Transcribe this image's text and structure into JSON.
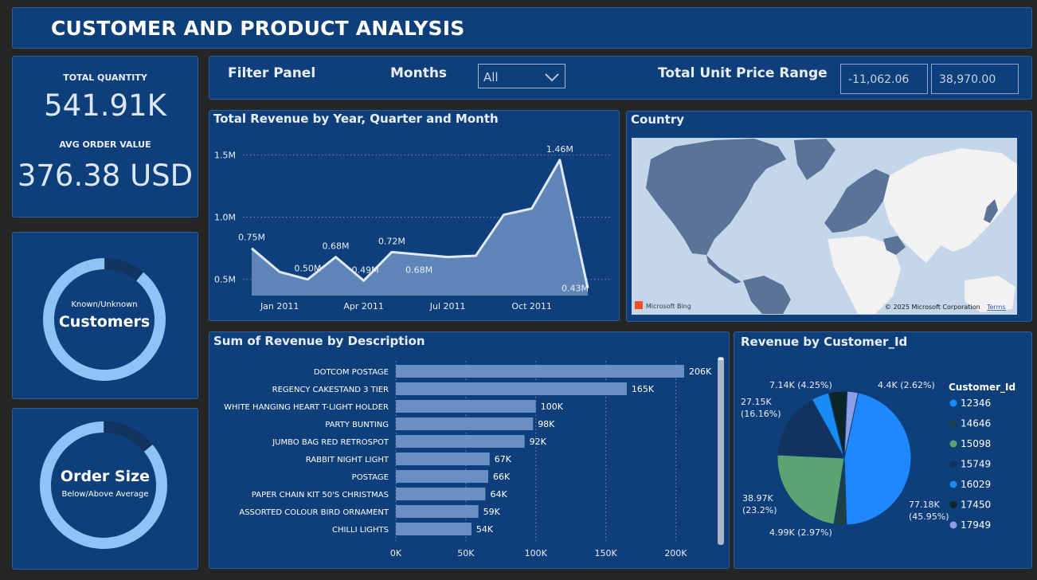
{
  "header": {
    "title": "CUSTOMER AND PRODUCT ANALYSIS"
  },
  "kpis": {
    "total_quantity_label": "TOTAL QUANTITY",
    "total_quantity_value": "541.91K",
    "avg_order_label": "AVG ORDER VALUE",
    "avg_order_value": "376.38 USD"
  },
  "customers_gauge": {
    "line1": "Known/Unknown",
    "line2": "Customers",
    "fraction": 0.89
  },
  "order_size_gauge": {
    "line1": "Order Size",
    "line2": "Below/Above Average",
    "fraction": 0.86
  },
  "filter": {
    "panel_label": "Filter Panel",
    "months_label": "Months",
    "months_value": "All",
    "range_label": "Total Unit Price Range",
    "range_min": "-11,062.06",
    "range_max": "38,970.00"
  },
  "revenue_by_month": {
    "title": "Total Revenue by Year, Quarter and Month"
  },
  "country": {
    "title": "Country",
    "bing_label": "Microsoft Bing",
    "copyright": "© 2025 Microsoft Corporation",
    "terms": "Terms"
  },
  "revenue_by_description": {
    "title": "Sum of Revenue by Description"
  },
  "revenue_by_customer": {
    "title": "Revenue by Customer_Id",
    "legend_title": "Customer_Id"
  },
  "colors": {
    "background": "#262626",
    "panel": "#0f3f7a",
    "accent": "#8ec4f5",
    "line_fill": "#5f85b8",
    "bar": "#6a8fc4"
  },
  "chart_data": [
    {
      "type": "area",
      "title": "Total Revenue by Year, Quarter and Month",
      "x": [
        "Dec 2010",
        "Jan 2011",
        "Feb 2011",
        "Mar 2011",
        "Apr 2011",
        "May 2011",
        "Jun 2011",
        "Jul 2011",
        "Aug 2011",
        "Sep 2011",
        "Oct 2011",
        "Nov 2011",
        "Dec 2011"
      ],
      "x_tick_labels": [
        "Jan 2011",
        "Apr 2011",
        "Jul 2011",
        "Oct 2011"
      ],
      "values": [
        750000,
        560000,
        500000,
        680000,
        490000,
        720000,
        700000,
        680000,
        690000,
        1020000,
        1070000,
        1460000,
        430000
      ],
      "data_labels": [
        "0.75M",
        "",
        "0.50M",
        "0.68M",
        "0.49M",
        "0.72M",
        "",
        "0.68M",
        "",
        "",
        "",
        "1.46M",
        "0.43M"
      ],
      "y_tick_labels": [
        "0.5M",
        "1.0M",
        "1.5M"
      ],
      "y_ticks": [
        500000,
        1000000,
        1500000
      ],
      "ylim": [
        370000,
        1600000
      ],
      "grid": true
    },
    {
      "type": "bar",
      "orientation": "horizontal",
      "title": "Sum of Revenue by Description",
      "categories": [
        "DOTCOM POSTAGE",
        "REGENCY CAKESTAND 3 TIER",
        "WHITE HANGING HEART T-LIGHT HOLDER",
        "PARTY BUNTING",
        "JUMBO BAG RED RETROSPOT",
        "RABBIT NIGHT LIGHT",
        "POSTAGE",
        "PAPER CHAIN KIT 50'S CHRISTMAS",
        "ASSORTED COLOUR BIRD ORNAMENT",
        "CHILLI LIGHTS"
      ],
      "values": [
        206000,
        165000,
        100000,
        98000,
        92000,
        67000,
        66000,
        64000,
        59000,
        54000
      ],
      "data_labels": [
        "206K",
        "165K",
        "100K",
        "98K",
        "92K",
        "67K",
        "66K",
        "64K",
        "59K",
        "54K"
      ],
      "x_tick_labels": [
        "0K",
        "50K",
        "100K",
        "150K",
        "200K"
      ],
      "x_ticks": [
        0,
        50000,
        100000,
        150000,
        200000
      ],
      "xlim": [
        0,
        210000
      ],
      "grid": true
    },
    {
      "type": "pie",
      "title": "Revenue by Customer_Id",
      "legend_title": "Customer_Id",
      "legend_position": "right",
      "slices": [
        {
          "name": "12346",
          "value": 77180,
          "percent": 45.95,
          "label": "77.18K (45.95%)",
          "color": "#1e88ff"
        },
        {
          "name": "14646",
          "value": 4990,
          "percent": 2.97,
          "label": "4.99K (2.97%)",
          "color": "#1d3f45"
        },
        {
          "name": "15098",
          "value": 38970,
          "percent": 23.2,
          "label": "38.97K (23.2%)",
          "color": "#5aa472"
        },
        {
          "name": "15749",
          "value": 27150,
          "percent": 16.16,
          "label": "27.15K (16.16%)",
          "color": "#12325f"
        },
        {
          "name": "16029",
          "value": 7140,
          "percent": 4.25,
          "label": "7.14K (4.25%)",
          "color": "#168cf4"
        },
        {
          "name": "17450",
          "value": 7450,
          "percent": 4.25,
          "label": "",
          "color": "#0d2428"
        },
        {
          "name": "17949",
          "value": 4400,
          "percent": 2.62,
          "label": "4.4K (2.62%)",
          "color": "#8c9fe6"
        }
      ]
    }
  ]
}
